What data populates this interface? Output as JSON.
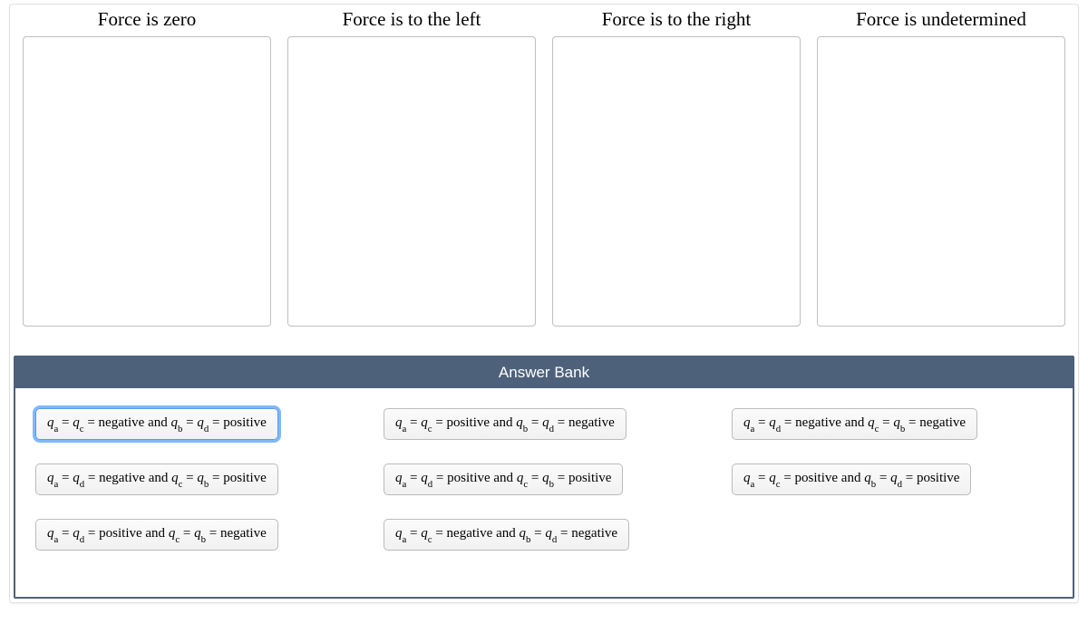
{
  "columns": [
    {
      "title": "Force is zero"
    },
    {
      "title": "Force is to the left"
    },
    {
      "title": "Force is to the right"
    },
    {
      "title": "Force is undetermined"
    }
  ],
  "answer_bank": {
    "title": "Answer Bank",
    "items": [
      {
        "pair1_a": "a",
        "pair1_b": "c",
        "sign1": "negative",
        "pair2_a": "b",
        "pair2_b": "d",
        "sign2": "positive",
        "selected": true
      },
      {
        "pair1_a": "a",
        "pair1_b": "c",
        "sign1": "positive",
        "pair2_a": "b",
        "pair2_b": "d",
        "sign2": "negative",
        "selected": false
      },
      {
        "pair1_a": "a",
        "pair1_b": "d",
        "sign1": "negative",
        "pair2_a": "c",
        "pair2_b": "b",
        "sign2": "negative",
        "selected": false
      },
      {
        "pair1_a": "a",
        "pair1_b": "d",
        "sign1": "negative",
        "pair2_a": "c",
        "pair2_b": "b",
        "sign2": "positive",
        "selected": false
      },
      {
        "pair1_a": "a",
        "pair1_b": "d",
        "sign1": "positive",
        "pair2_a": "c",
        "pair2_b": "b",
        "sign2": "positive",
        "selected": false
      },
      {
        "pair1_a": "a",
        "pair1_b": "c",
        "sign1": "positive",
        "pair2_a": "b",
        "pair2_b": "d",
        "sign2": "positive",
        "selected": false
      },
      {
        "pair1_a": "a",
        "pair1_b": "d",
        "sign1": "positive",
        "pair2_a": "c",
        "pair2_b": "b",
        "sign2": "negative",
        "selected": false
      },
      {
        "pair1_a": "a",
        "pair1_b": "c",
        "sign1": "negative",
        "pair2_a": "b",
        "pair2_b": "d",
        "sign2": "negative",
        "selected": false
      }
    ]
  }
}
